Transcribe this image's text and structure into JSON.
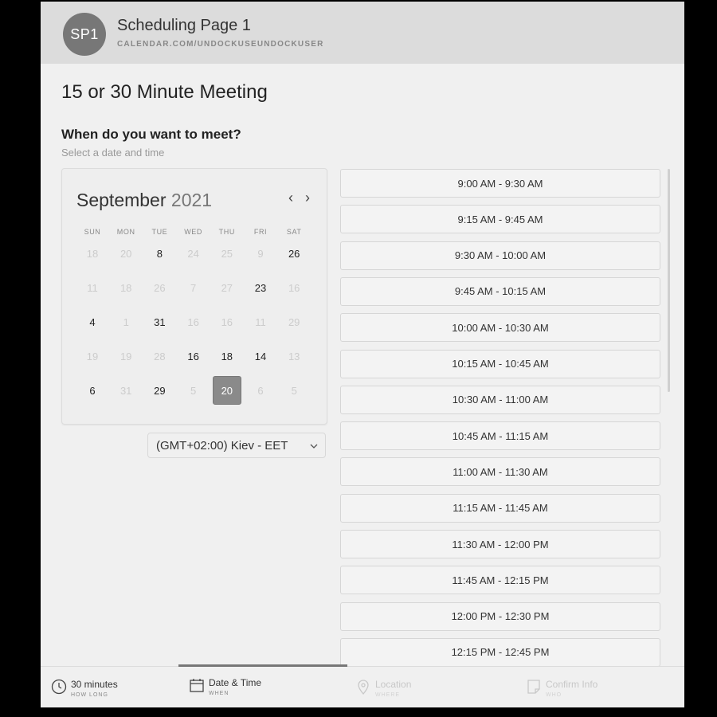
{
  "header": {
    "avatar_text": "SP1",
    "title": "Scheduling Page 1",
    "url": "CALENDAR.COM/UNDOCKUSEUNDOCKUSER"
  },
  "meeting_title": "15 or 30 Minute Meeting",
  "question": "When do you want to meet?",
  "question_hint": "Select a date and time",
  "calendar": {
    "month": "September",
    "year": "2021",
    "prev_label": "‹",
    "next_label": "›",
    "weekdays": [
      "SUN",
      "MON",
      "TUE",
      "WED",
      "THU",
      "FRI",
      "SAT"
    ],
    "weeks": [
      [
        {
          "d": "18",
          "a": false
        },
        {
          "d": "20",
          "a": false
        },
        {
          "d": "8",
          "a": true
        },
        {
          "d": "24",
          "a": false
        },
        {
          "d": "25",
          "a": false
        },
        {
          "d": "9",
          "a": false
        },
        {
          "d": "26",
          "a": true
        }
      ],
      [
        {
          "d": "11",
          "a": false
        },
        {
          "d": "18",
          "a": false
        },
        {
          "d": "26",
          "a": false
        },
        {
          "d": "7",
          "a": false
        },
        {
          "d": "27",
          "a": false
        },
        {
          "d": "23",
          "a": true
        },
        {
          "d": "16",
          "a": false
        }
      ],
      [
        {
          "d": "4",
          "a": true
        },
        {
          "d": "1",
          "a": false
        },
        {
          "d": "31",
          "a": true
        },
        {
          "d": "16",
          "a": false
        },
        {
          "d": "16",
          "a": false
        },
        {
          "d": "11",
          "a": false
        },
        {
          "d": "29",
          "a": false
        }
      ],
      [
        {
          "d": "19",
          "a": false
        },
        {
          "d": "19",
          "a": false
        },
        {
          "d": "28",
          "a": false
        },
        {
          "d": "16",
          "a": true
        },
        {
          "d": "18",
          "a": true
        },
        {
          "d": "14",
          "a": true
        },
        {
          "d": "13",
          "a": false
        }
      ],
      [
        {
          "d": "6",
          "a": true
        },
        {
          "d": "31",
          "a": false
        },
        {
          "d": "29",
          "a": true
        },
        {
          "d": "5",
          "a": false
        },
        {
          "d": "20",
          "a": true,
          "selected": true
        },
        {
          "d": "6",
          "a": false
        },
        {
          "d": "5",
          "a": false
        }
      ]
    ]
  },
  "timezone": "(GMT+02:00) Kiev - EET",
  "time_slots": [
    "9:00 AM - 9:30 AM",
    "9:15 AM - 9:45 AM",
    "9:30 AM - 10:00 AM",
    "9:45 AM - 10:15 AM",
    "10:00 AM - 10:30 AM",
    "10:15 AM - 10:45 AM",
    "10:30 AM - 11:00 AM",
    "10:45 AM - 11:15 AM",
    "11:00 AM - 11:30 AM",
    "11:15 AM - 11:45 AM",
    "11:30 AM - 12:00 PM",
    "11:45 AM - 12:15 PM",
    "12:00 PM - 12:30 PM",
    "12:15 PM - 12:45 PM"
  ],
  "footer": {
    "steps": [
      {
        "label": "30 minutes",
        "sub": "HOW LONG",
        "icon": "clock-icon",
        "state": "done"
      },
      {
        "label": "Date & Time",
        "sub": "WHEN",
        "icon": "calendar-icon",
        "state": "active"
      },
      {
        "label": "Location",
        "sub": "WHERE",
        "icon": "location-pin-icon",
        "state": "pending"
      },
      {
        "label": "Confirm Info",
        "sub": "WHO",
        "icon": "note-icon",
        "state": "pending"
      }
    ]
  }
}
